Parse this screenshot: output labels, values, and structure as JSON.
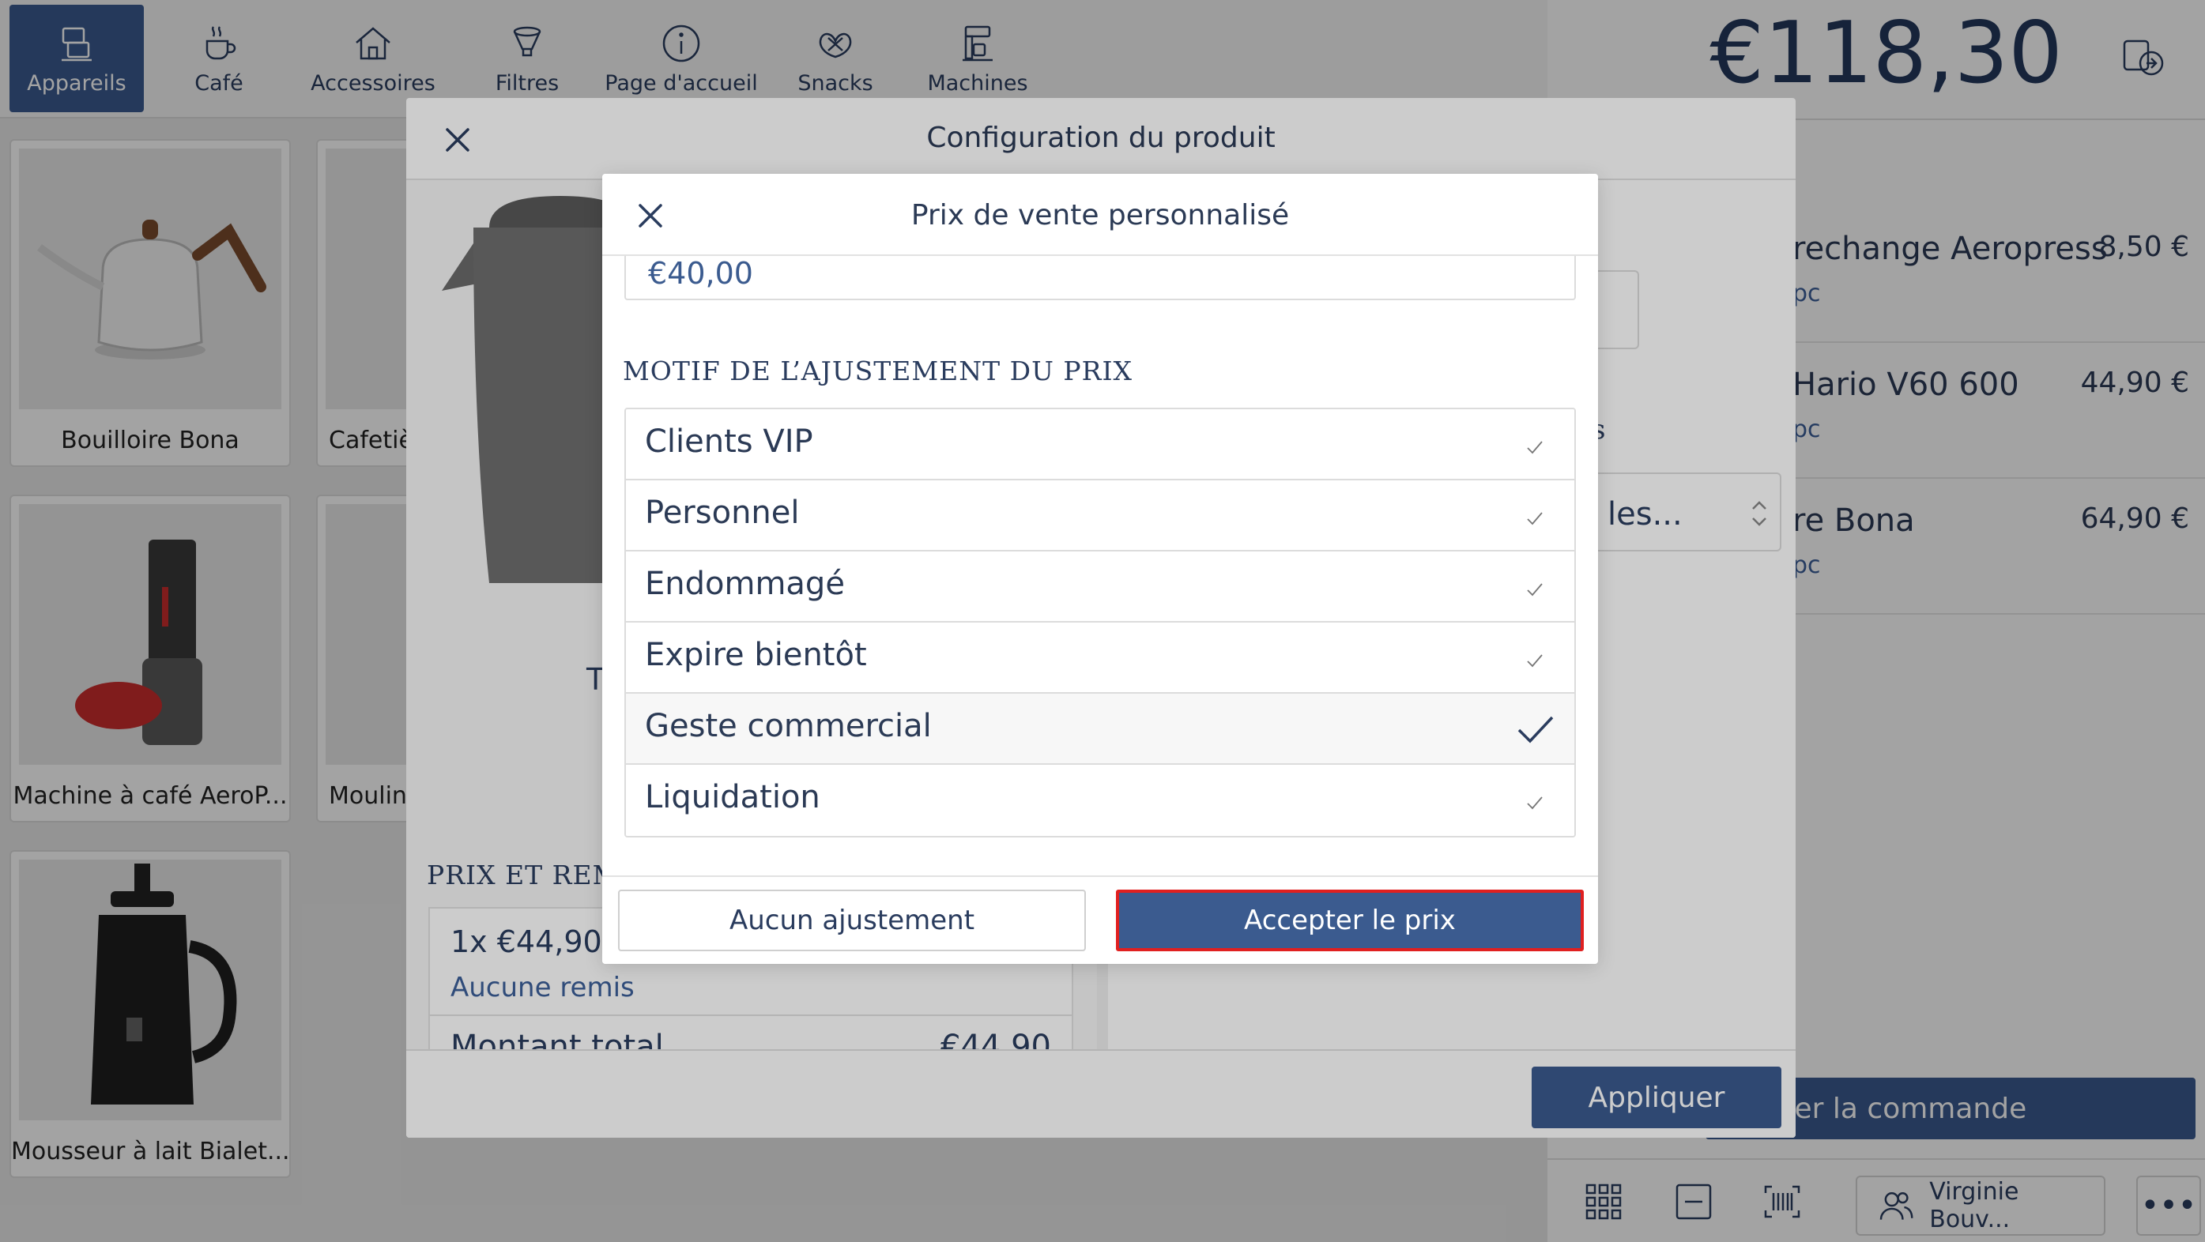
{
  "nav": {
    "items": [
      {
        "label": "Appareils",
        "active": true,
        "icon": "devices-icon"
      },
      {
        "label": "Café",
        "active": false,
        "icon": "coffee-cup-icon"
      },
      {
        "label": "Accessoires",
        "active": false,
        "icon": "home-icon"
      },
      {
        "label": "Filtres",
        "active": false,
        "icon": "filter-icon"
      },
      {
        "label": "Page d'accueil",
        "active": false,
        "icon": "info-icon"
      },
      {
        "label": "Snacks",
        "active": false,
        "icon": "pretzel-icon"
      },
      {
        "label": "Machines",
        "active": false,
        "icon": "machine-icon"
      }
    ]
  },
  "products": [
    {
      "label": "Bouilloire Bona"
    },
    {
      "label": "Cafetièr"
    },
    {
      "label": "Machine à café AeroP..."
    },
    {
      "label": "Moulin"
    },
    {
      "label": "Mousseur à lait Bialet..."
    }
  ],
  "cart": {
    "total": "€118,30",
    "items": [
      {
        "name": "rechange Aeropress",
        "qty": "pc",
        "price": "8,50 €"
      },
      {
        "name": "Hario V60 600",
        "qty": "pc",
        "price": "44,90 €"
      },
      {
        "name": "re Bona",
        "qty": "pc",
        "price": "64,90 €"
      }
    ],
    "order_button": "isser la commande",
    "customer": "Virginie Bouv...",
    "more": "•••"
  },
  "config_modal": {
    "title": "Configuration du produit",
    "product_name": "T",
    "section_price": "PRIX ET REMIS",
    "price_line": "1x €44,90",
    "discount": "Aucune remis",
    "total_label": "Montant total",
    "total_value": "€44,90",
    "side_label": "s",
    "select_value": "les...",
    "apply_button": "Appliquer"
  },
  "price_dialog": {
    "title": "Prix de vente personnalisé",
    "price_value": "€40,00",
    "reason_heading": "MOTIF DE L’AJUSTEMENT DU PRIX",
    "options": [
      {
        "label": "Clients VIP",
        "selected": false
      },
      {
        "label": "Personnel",
        "selected": false
      },
      {
        "label": "Endommagé",
        "selected": false
      },
      {
        "label": "Expire bientôt",
        "selected": false
      },
      {
        "label": "Geste commercial",
        "selected": true
      },
      {
        "label": "Liquidation",
        "selected": false
      }
    ],
    "no_adjust_button": "Aucun ajustement",
    "accept_button": "Accepter le prix"
  },
  "colors": {
    "primary": "#3b5b8f",
    "text": "#2a3c5e",
    "highlight_border": "#e02020"
  }
}
